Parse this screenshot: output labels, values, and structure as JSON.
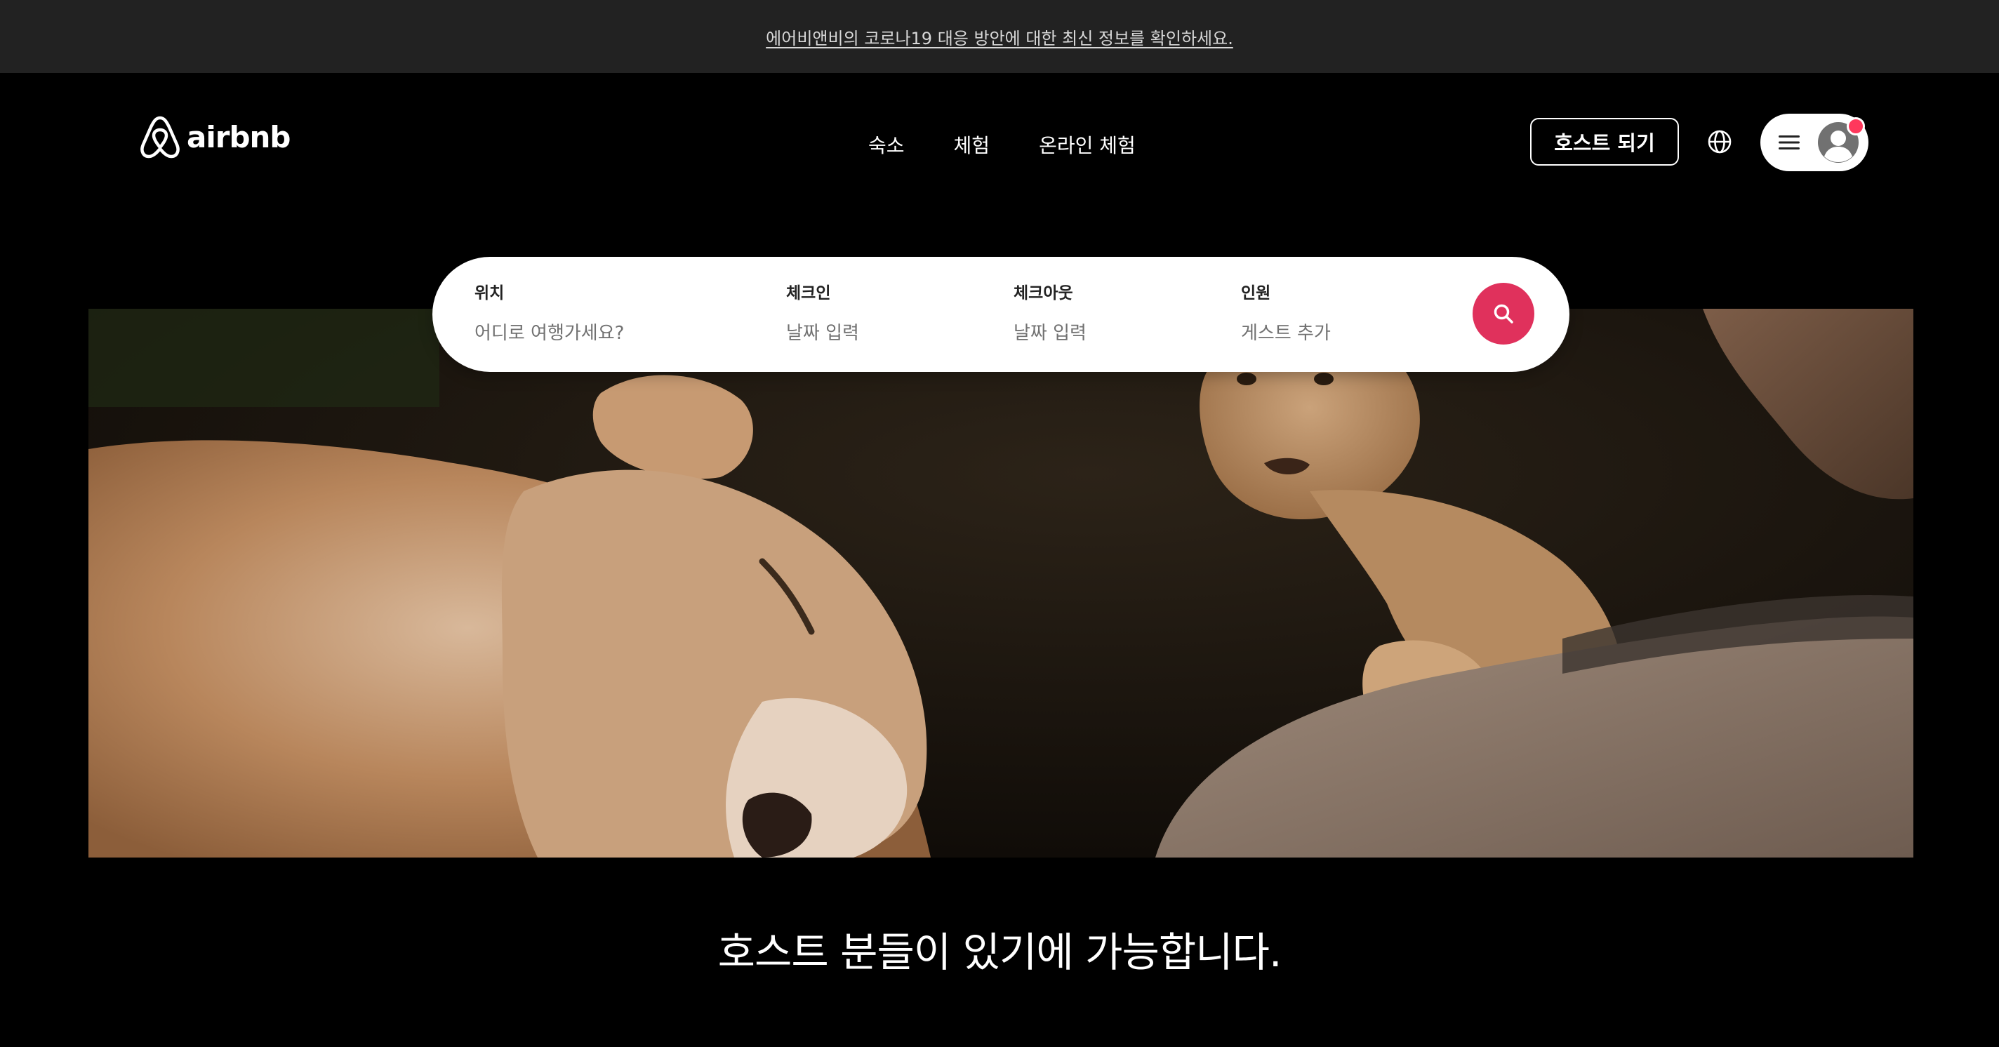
{
  "banner": {
    "text": "에어비앤비의 코로나19 대응 방안에 대한 최신 정보를 확인하세요."
  },
  "header": {
    "logo_text": "airbnb",
    "nav": [
      "숙소",
      "체험",
      "온라인 체험"
    ],
    "host_button": "호스트 되기",
    "globe_icon": "globe-icon",
    "menu_icon": "hamburger-icon",
    "avatar_icon": "user-avatar-icon",
    "notification_color": "#ff385c"
  },
  "search": {
    "location": {
      "label": "위치",
      "placeholder": "어디로 여행가세요?"
    },
    "checkin": {
      "label": "체크인",
      "placeholder": "날짜 입력"
    },
    "checkout": {
      "label": "체크아웃",
      "placeholder": "날짜 입력"
    },
    "guests": {
      "label": "인원",
      "placeholder": "게스트 추가"
    },
    "button_color": "#e0315c",
    "button_icon": "search-icon"
  },
  "hero": {
    "image": "lioness-and-cub-photo"
  },
  "headline": "호스트 분들이 있기에 가능합니다."
}
